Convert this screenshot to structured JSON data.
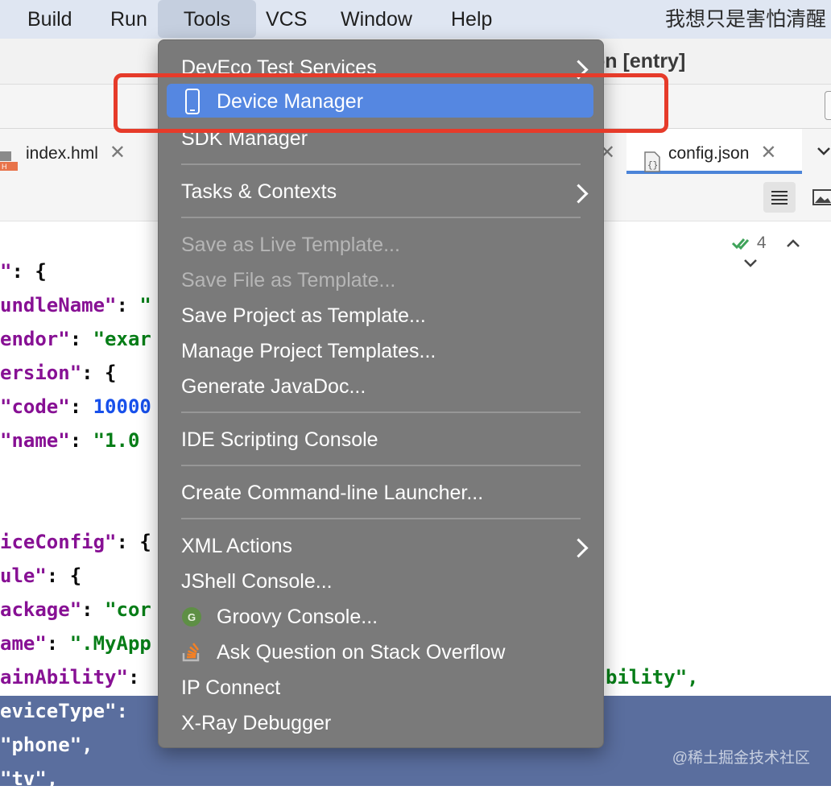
{
  "menubar": {
    "items": [
      "Build",
      "Run",
      "Tools",
      "VCS",
      "Window",
      "Help"
    ],
    "active": "Tools",
    "user": "我想只是害怕清醒"
  },
  "window": {
    "title": "on [entry]"
  },
  "tabs": [
    {
      "label": "index.hml"
    },
    {
      "label": "config.json",
      "active": true
    }
  ],
  "editor": {
    "inspection_count": "4",
    "lines": [
      [
        [
          "k",
          "\""
        ],
        [
          "p",
          ": {"
        ]
      ],
      [
        [
          "k",
          "undleName\""
        ],
        [
          "p",
          ": "
        ],
        [
          "s",
          "\""
        ]
      ],
      [
        [
          "k",
          "endor\""
        ],
        [
          "p",
          ": "
        ],
        [
          "s",
          "\"exar"
        ]
      ],
      [
        [
          "k",
          "ersion\""
        ],
        [
          "p",
          ": {"
        ]
      ],
      [
        [
          "k",
          "\"code\""
        ],
        [
          "p",
          ": "
        ],
        [
          "n",
          "10000"
        ]
      ],
      [
        [
          "k",
          "\"name\""
        ],
        [
          "p",
          ": "
        ],
        [
          "s",
          "\"1.0"
        ]
      ],
      [
        [
          "k",
          "iceConfig\""
        ],
        [
          "p",
          ": {"
        ]
      ],
      [
        [
          "k",
          "ule\""
        ],
        [
          "p",
          ": {"
        ]
      ],
      [
        [
          "k",
          "ackage\""
        ],
        [
          "p",
          ": "
        ],
        [
          "s",
          "\"cor"
        ]
      ],
      [
        [
          "k",
          "ame\""
        ],
        [
          "p",
          ": "
        ],
        [
          "s",
          "\".MyApp"
        ]
      ],
      [
        [
          "k",
          "ainAbility\""
        ],
        [
          "p",
          ": "
        ]
      ],
      [
        [
          "k",
          "eviceType\""
        ],
        [
          "p",
          ":"
        ]
      ],
      [
        [
          "s",
          "\"phone\""
        ],
        [
          "p",
          ","
        ]
      ],
      [
        [
          "s",
          "\"tv\""
        ],
        [
          "p",
          ","
        ]
      ]
    ],
    "right_fragment": "bility\","
  },
  "menu": {
    "items": [
      {
        "label": "DevEco Test Services",
        "submenu": true
      },
      {
        "label": "Device Manager",
        "icon": "phone-icon",
        "highlighted": true
      },
      {
        "label": "SDK Manager"
      },
      {
        "label": "Tasks & Contexts",
        "submenu": true
      },
      {
        "label": "Save as Live Template...",
        "disabled": true
      },
      {
        "label": "Save File as Template...",
        "disabled": true
      },
      {
        "label": "Save Project as Template..."
      },
      {
        "label": "Manage Project Templates..."
      },
      {
        "label": "Generate JavaDoc..."
      },
      {
        "label": "IDE Scripting Console"
      },
      {
        "label": "Create Command-line Launcher..."
      },
      {
        "label": "XML Actions",
        "submenu": true
      },
      {
        "label": "JShell Console..."
      },
      {
        "label": "Groovy Console...",
        "icon": "groovy-icon"
      },
      {
        "label": "Ask Question on Stack Overflow",
        "icon": "stackoverflow-icon"
      },
      {
        "label": "IP Connect"
      },
      {
        "label": "X-Ray Debugger"
      }
    ]
  },
  "watermark": "@稀土掘金技术社区",
  "colors": {
    "highlight": "#5587e1",
    "annotation": "#e63b2a",
    "menu_bg": "#7a7a7a"
  }
}
